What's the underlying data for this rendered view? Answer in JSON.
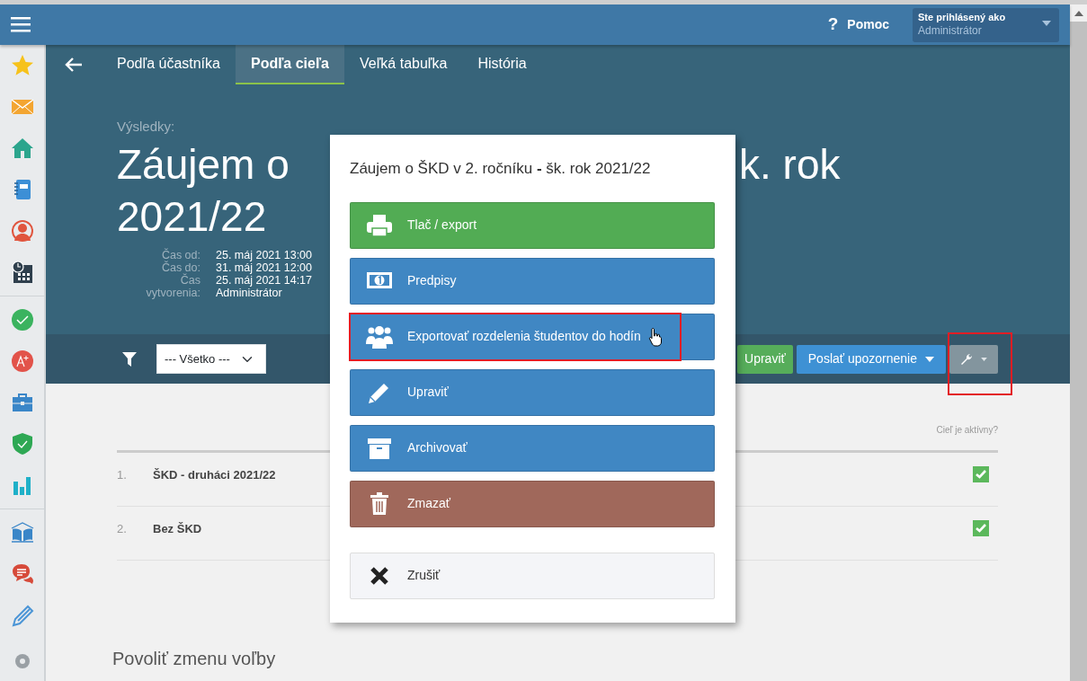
{
  "topbar": {
    "help_icon": "?",
    "help": "Pomoc",
    "user_label": "Ste prihlásený ako",
    "user_name": "Administrátor"
  },
  "tabs": [
    {
      "label": "Podľa účastníka",
      "selected": false
    },
    {
      "label": "Podľa cieľa",
      "selected": true
    },
    {
      "label": "Veľká tabuľka",
      "selected": false
    },
    {
      "label": "História",
      "selected": false
    }
  ],
  "header": {
    "overline": "Výsledky:",
    "title_left": "Záujem o",
    "title_right": "k. rok",
    "title_line2": "2021/22",
    "meta": [
      {
        "label": "Čas od:",
        "values": [
          "25. máj 2021 13:00"
        ]
      },
      {
        "label": "Čas do:",
        "values": [
          "31. máj 2021 12:00"
        ]
      },
      {
        "label": "Čas vytvorenia:",
        "values": [
          "25. máj 2021 14:17",
          "Administrátor"
        ]
      }
    ]
  },
  "toolbar": {
    "filter": {
      "value": "--- Všetko ---"
    },
    "buttons": [
      {
        "kind": "success",
        "label": "Upraviť",
        "highlighted": false
      },
      {
        "kind": "dropdown",
        "label": "Poslať upozornenie",
        "highlighted": false
      },
      {
        "kind": "tools",
        "highlighted": true
      }
    ]
  },
  "table": {
    "columns": [
      "Cieľ je aktívny?"
    ],
    "rows": [
      {
        "number": "1.",
        "name": "ŠKD - druháci 2021/22",
        "active": true
      },
      {
        "number": "2.",
        "name": "Bez ŠKD",
        "active": true
      }
    ]
  },
  "section_title": "Povoliť zmenu voľby",
  "modal": {
    "title": "Záujem o ŠKD v 2. ročníku **-** šk. rok 2021/22",
    "items": [
      {
        "kind": "success",
        "label": "Tlač / export",
        "highlighted": false,
        "hovered": false
      },
      {
        "kind": "primary",
        "label": "Predpisy",
        "highlighted": false,
        "hovered": false
      },
      {
        "kind": "primary",
        "label": "Exportovať rozdelenia študentov do hodín",
        "highlighted": true,
        "hovered": true
      },
      {
        "kind": "primary",
        "label": "Upraviť",
        "highlighted": false,
        "hovered": false
      },
      {
        "kind": "primary",
        "label": "Archivovať",
        "highlighted": false,
        "hovered": false
      },
      {
        "kind": "danger",
        "label": "Zmazať",
        "highlighted": false,
        "hovered": false
      }
    ],
    "cancel": {
      "label": "Zrušiť"
    }
  }
}
